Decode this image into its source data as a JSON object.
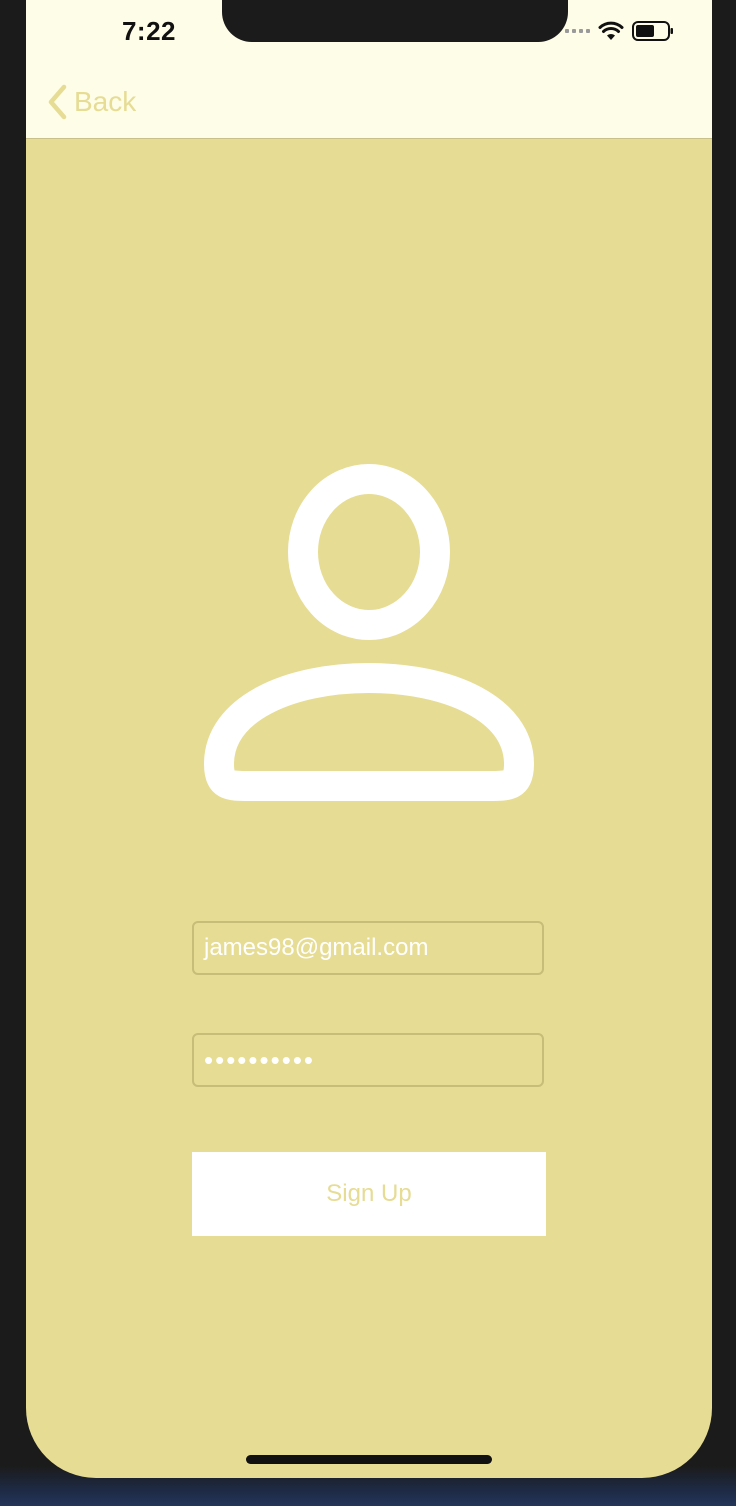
{
  "status_bar": {
    "time": "7:22"
  },
  "nav": {
    "back_label": "Back"
  },
  "form": {
    "email_value": "james98@gmail.com",
    "password_masked": "••••••••••",
    "signup_label": "Sign Up"
  },
  "colors": {
    "background": "#e6dc94",
    "navbar": "#fefde8",
    "accent": "#e6dc94",
    "button": "#ffffff"
  },
  "icons": {
    "avatar": "person-outline-icon",
    "back": "chevron-left-icon",
    "wifi": "wifi-icon",
    "battery": "battery-icon"
  }
}
